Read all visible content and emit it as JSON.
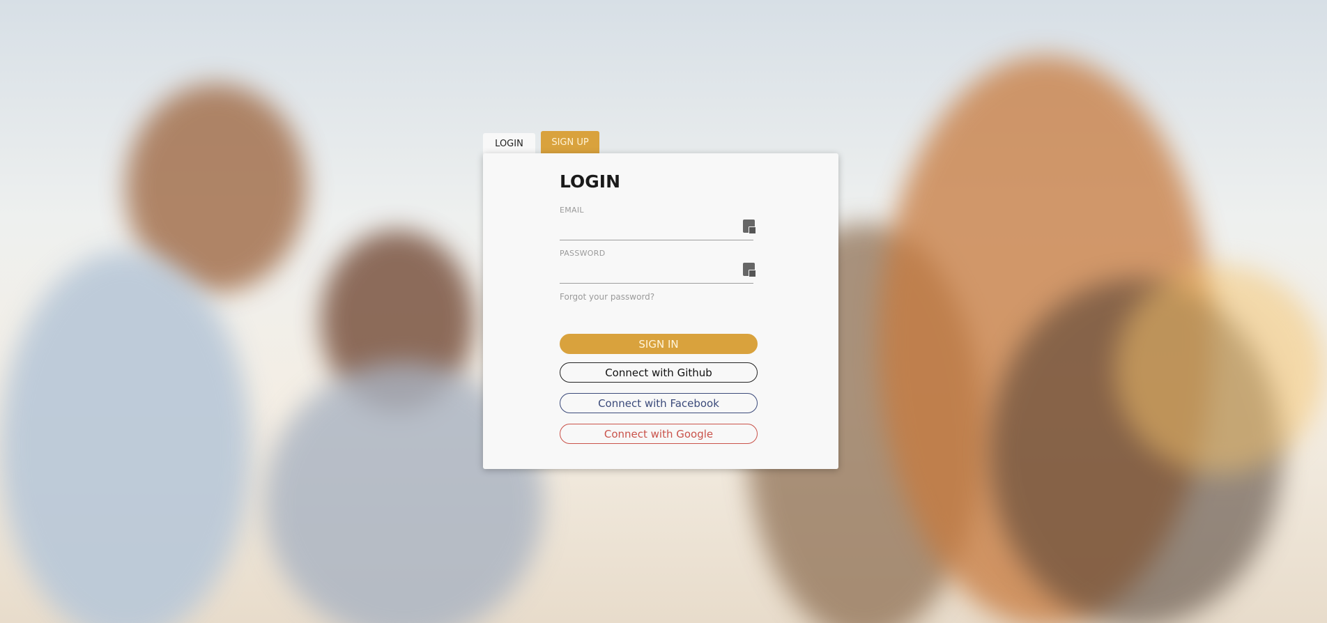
{
  "tabs": {
    "login": "LOGIN",
    "signup": "SIGN UP"
  },
  "form": {
    "title": "LOGIN",
    "email_label": "EMAIL",
    "email_value": "",
    "password_label": "PASSWORD",
    "password_value": "",
    "forgot": "Forgot your password?",
    "signin": "SIGN IN",
    "github": "Connect with Github",
    "facebook": "Connect with Facebook",
    "google": "Connect with Google"
  },
  "colors": {
    "accent": "#d9a23d",
    "facebook": "#3b4a7a",
    "google": "#c9524a"
  },
  "icons": {
    "field_icon": "keyboard-icon"
  }
}
